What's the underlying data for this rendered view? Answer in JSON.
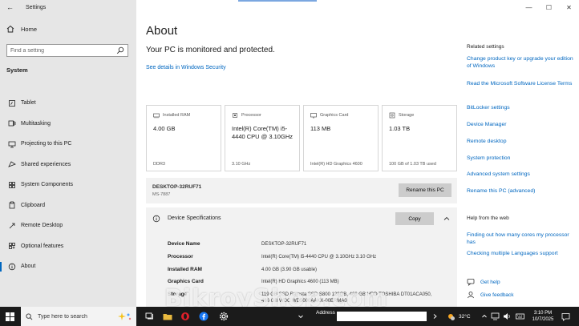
{
  "window": {
    "title": "Settings"
  },
  "sidebar": {
    "home_label": "Home",
    "search_placeholder": "Find a setting",
    "section_title": "System",
    "items": [
      {
        "label": "Tablet"
      },
      {
        "label": "Multitasking"
      },
      {
        "label": "Projecting to this PC"
      },
      {
        "label": "Shared experiences"
      },
      {
        "label": "System Components"
      },
      {
        "label": "Clipboard"
      },
      {
        "label": "Remote Desktop"
      },
      {
        "label": "Optional features"
      },
      {
        "label": "About"
      }
    ]
  },
  "main": {
    "title": "About",
    "protection_text": "Your PC is monitored and protected.",
    "security_link": "See details in Windows Security",
    "cards": [
      {
        "label": "Installed RAM",
        "value": "4.00 GB",
        "sub": "DDR3"
      },
      {
        "label": "Processor",
        "value": "Intel(R) Core(TM) i5-4440 CPU @ 3.10GHz",
        "sub": "3.10 GHz"
      },
      {
        "label": "Graphics Card",
        "value": "113 MB",
        "sub": "Intel(R) HD Graphics 4600"
      },
      {
        "label": "Storage",
        "value": "1.03 TB",
        "sub": "100 GB of 1.03 TB used"
      }
    ],
    "pc_name": "DESKTOP-32RUF71",
    "pc_model": "MS-7887",
    "rename_button": "Rename this PC",
    "device_spec_title": "Device Specifications",
    "copy_button": "Copy",
    "specs": [
      {
        "key": "Device Name",
        "value": "DESKTOP-32RUF71"
      },
      {
        "key": "Processor",
        "value": "Intel(R) Core(TM) i5-4440 CPU @ 3.10GHz   3.10 GHz"
      },
      {
        "key": "Installed RAM",
        "value": "4.00 GB (3.90 GB usable)"
      },
      {
        "key": "Graphics Card",
        "value": "Intel(R) HD Graphics 4600 (113 MB)"
      },
      {
        "key": "Storage",
        "value": "119 GB SSD Ramsta SSD S800 128GB, 466 GB HDD TOSHIBA DT01ACA050, 466 GB WDC WD5000AAKX-00ERMA0"
      }
    ]
  },
  "related": {
    "title": "Related settings",
    "links": [
      "Change product key or upgrade your edition of Windows",
      "Read the Microsoft Software License Terms",
      "BitLocker settings",
      "Device Manager",
      "Remote desktop",
      "System protection",
      "Advanced system settings",
      "Rename this PC (advanced)"
    ],
    "help_title": "Help from the web",
    "help_links": [
      "Finding out how many cores my processor has",
      "Checking multiple Languages support"
    ],
    "get_help": "Get help",
    "give_feedback": "Give feedback"
  },
  "window_controls": {
    "minimize": "—",
    "maximize": "☐",
    "close": "✕"
  },
  "taskbar": {
    "search_placeholder": "Type here to search",
    "address_label": "Address",
    "weather": "32°C",
    "time": "3:10 PM",
    "date": "10/7/2025"
  },
  "watermark": "BikroyShop.com",
  "colors": {
    "accent": "#0067c0",
    "sidebar_bg": "#e6e6e6",
    "panel_bg": "#f2f2f2",
    "button_bg": "#cccccc",
    "taskbar_bg": "#1b1b1b"
  }
}
